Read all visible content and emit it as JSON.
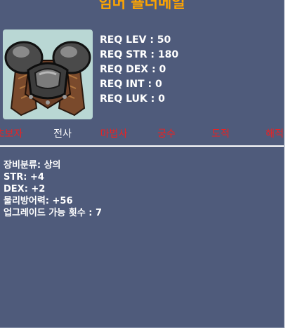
{
  "item": {
    "name": "임머 숄더메일",
    "name_color": "#ffa500",
    "icon": "armor-shoulder-mail-icon"
  },
  "requirements": [
    "REQ LEV : 50",
    "REQ STR : 180",
    "REQ DEX : 0",
    "REQ INT : 0",
    "REQ LUK : 0"
  ],
  "jobs": [
    {
      "label": "초보자",
      "allowed": false
    },
    {
      "label": "전사",
      "allowed": true
    },
    {
      "label": "마법사",
      "allowed": false
    },
    {
      "label": "궁수",
      "allowed": false
    },
    {
      "label": "도적",
      "allowed": false
    },
    {
      "label": "해적",
      "allowed": false
    }
  ],
  "stats": [
    "장비분류: 상의",
    "STR: +4",
    "DEX: +2",
    "물리방어력: +56",
    "업그레이드 가능 횟수 : 7"
  ],
  "colors": {
    "background": "#4f5b7b",
    "job_allowed": "#ffffff",
    "job_denied": "#ee2020",
    "text": "#ffffff"
  }
}
